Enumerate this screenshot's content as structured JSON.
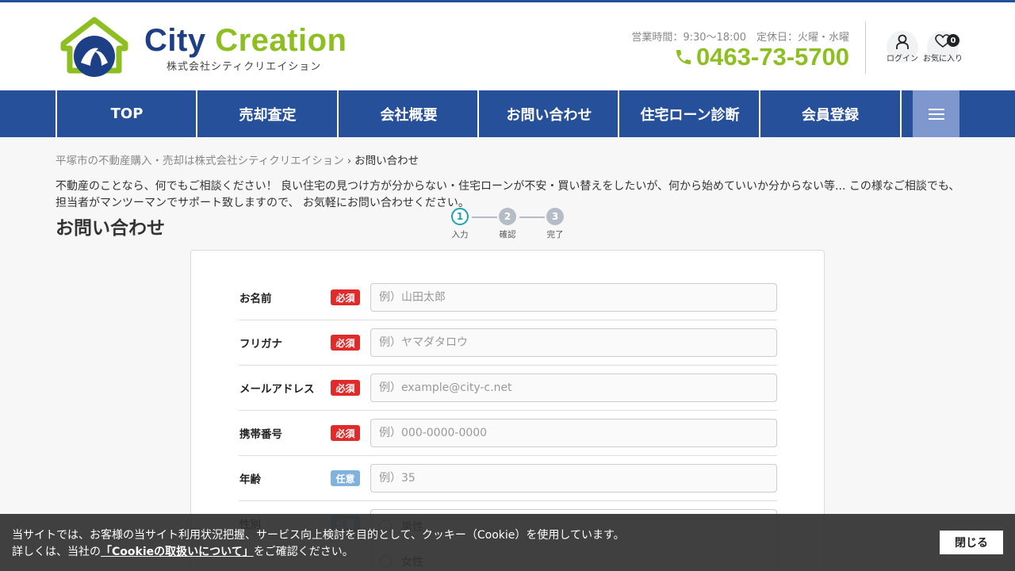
{
  "header": {
    "logo_brand_part1": "City",
    "logo_brand_part2": "Creation",
    "logo_subtitle": "株式会社シティクリエイション",
    "hours": "営業時間：9:30～18:00　定休日：火曜・水曜",
    "phone": "0463-73-5700",
    "login_label": "ログイン",
    "favorites_label": "お気に入り",
    "favorites_count": "0",
    "colors": {
      "brand_blue": "#1c3f86",
      "brand_green": "#8cbf1f",
      "nav_bg": "#27509a"
    }
  },
  "nav": {
    "items": [
      "TOP",
      "売却査定",
      "会社概要",
      "お問い合わせ",
      "住宅ローン診断",
      "会員登録"
    ],
    "menu_icon": "hamburger-icon"
  },
  "breadcrumb": {
    "home": "平塚市の不動産購入・売却は株式会社シティクリエイション",
    "separator": "›",
    "current": "お問い合わせ"
  },
  "intro": "不動産のことなら、何でもご相談ください！ 良い住宅の見つけ方が分からない・住宅ローンが不安・買い替えをしたいが、何から始めていいか分からない等... この様なご相談でも、担当者がマンツーマンでサポート致しますので、 お気軽にお問い合わせください。",
  "page_title": "お問い合わせ",
  "steps": [
    {
      "num": "1",
      "label": "入力"
    },
    {
      "num": "2",
      "label": "確認"
    },
    {
      "num": "3",
      "label": "完了"
    }
  ],
  "form": {
    "required_label": "必須",
    "optional_label": "任意",
    "fields": [
      {
        "label": "お名前",
        "placeholder": "例）山田太郎"
      },
      {
        "label": "フリガナ",
        "placeholder": "例）ヤマダタロウ"
      },
      {
        "label": "メールアドレス",
        "placeholder": "例）example@city-c.net"
      },
      {
        "label": "携帯番号",
        "placeholder": "例）000-0000-0000"
      },
      {
        "label": "年齢",
        "placeholder": "例）35"
      }
    ],
    "gender_label": "性別",
    "gender_options": [
      "男性",
      "女性"
    ]
  },
  "cookie": {
    "line1": "当サイトでは、お客様の当サイト利用状況把握、サービス向上検討を目的として、クッキー（Cookie）を使用しています。",
    "line2_prefix": "詳しくは、当社の",
    "line2_link": "「Cookieの取扱いについて」",
    "line2_suffix": "をご確認ください。",
    "close": "閉じる"
  }
}
